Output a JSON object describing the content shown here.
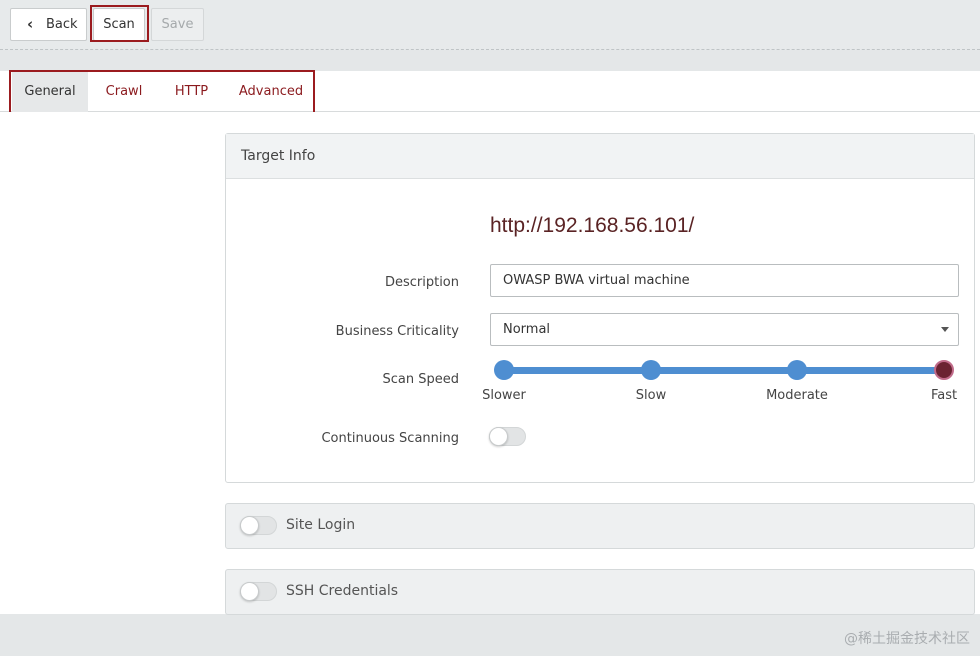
{
  "toolbar": {
    "back_label": "Back",
    "scan_label": "Scan",
    "save_label": "Save"
  },
  "tabs": [
    {
      "label": "General",
      "active": true
    },
    {
      "label": "Crawl",
      "active": false
    },
    {
      "label": "HTTP",
      "active": false
    },
    {
      "label": "Advanced",
      "active": false
    }
  ],
  "target_info": {
    "title": "Target Info",
    "url": "http://192.168.56.101/",
    "description_label": "Description",
    "description_value": "OWASP BWA virtual machine",
    "criticality_label": "Business Criticality",
    "criticality_value": "Normal",
    "speed_label": "Scan Speed",
    "speed_options": [
      "Slower",
      "Slow",
      "Moderate",
      "Fast"
    ],
    "speed_selected": "Fast",
    "continuous_label": "Continuous Scanning",
    "continuous_on": false
  },
  "sections": {
    "site_login": {
      "title": "Site Login",
      "enabled": false
    },
    "ssh": {
      "title": "SSH Credentials",
      "enabled": false
    }
  },
  "watermark": "@稀土掘金技术社区",
  "colors": {
    "accent": "#9b1b1f",
    "slider": "#4e8ed1",
    "selected_knob": "#6b2332"
  }
}
